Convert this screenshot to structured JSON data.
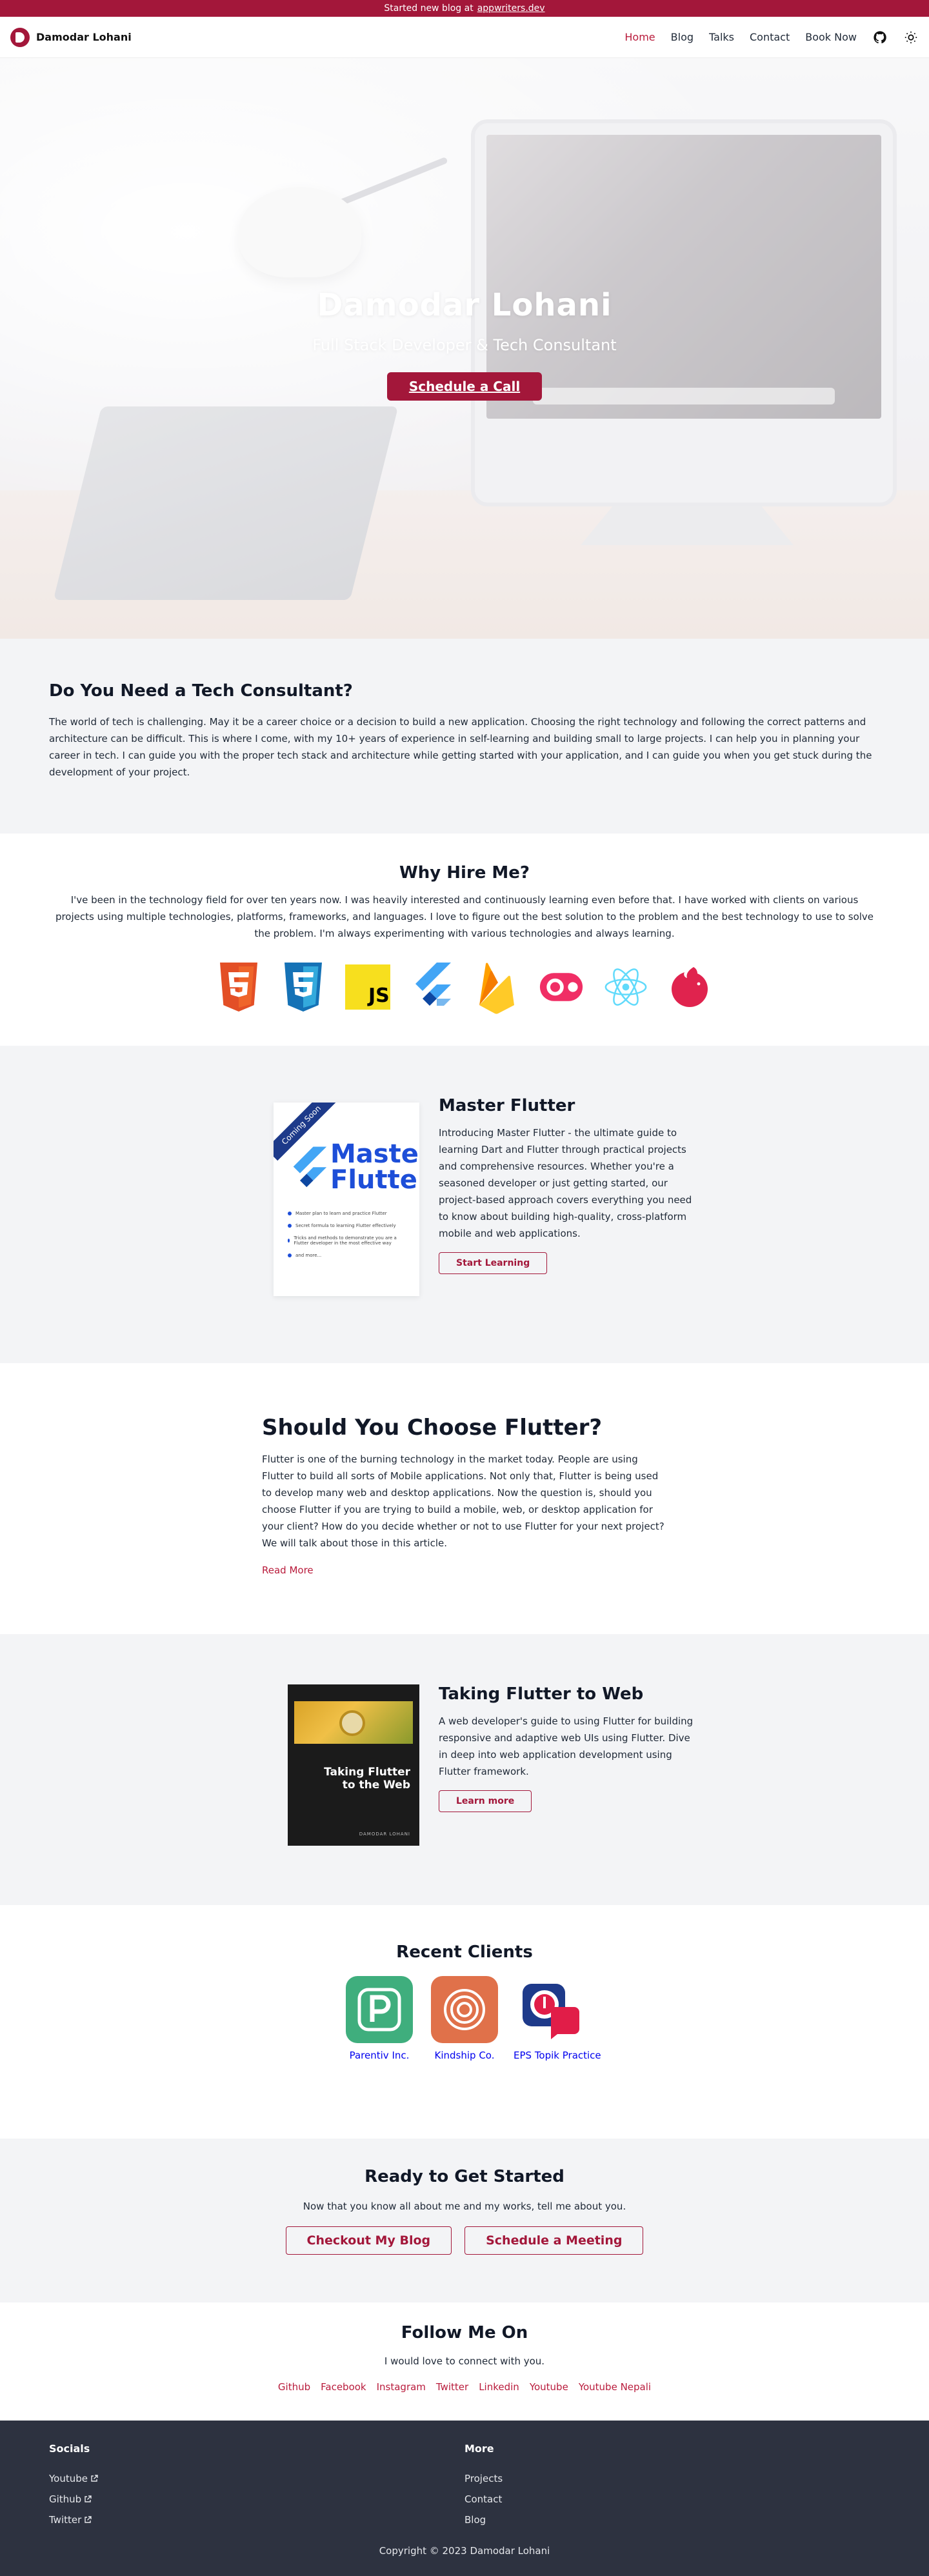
{
  "announcement": {
    "text": "Started new blog at",
    "link": "appwriters.dev"
  },
  "nav": {
    "brand": "Damodar Lohani",
    "links": [
      "Home",
      "Blog",
      "Talks",
      "Contact",
      "Book Now"
    ],
    "active_index": 0,
    "icons": [
      "github-icon",
      "sun-icon"
    ]
  },
  "hero": {
    "title": "Damodar Lohani",
    "subtitle": "Full Stack Developer & Tech Consultant",
    "cta": "Schedule a Call"
  },
  "consultant": {
    "title": "Do You Need a Tech Consultant?",
    "body": "The world of tech is challenging. May it be a career choice or a decision to build a new application. Choosing the right technology and following the correct patterns and architecture can be difficult. This is where I come, with my 10+ years of experience in self-learning and building small to large projects. I can help you in planning your career in tech. I can guide you with the proper tech stack and architecture while getting started with your application, and I can guide you when you get stuck during the development of your project."
  },
  "why_hire": {
    "title": "Why Hire Me?",
    "body": "I've been in the technology field for over ten years now. I was heavily interested and continuously learning even before that. I have worked with clients on various projects using multiple technologies, platforms, frameworks, and languages. I love to figure out the best solution to the problem and the best technology to use to solve the problem. I'm always experimenting with various technologies and always learning.",
    "tech_icons": [
      "html5-icon",
      "css3-icon",
      "javascript-icon",
      "flutter-icon",
      "firebase-icon",
      "appwrite-icon",
      "react-icon",
      "nestjs-icon"
    ]
  },
  "master_flutter": {
    "title": "Master Flutter",
    "body": "Introducing Master Flutter - the ultimate guide to learning Dart and Flutter through practical projects and comprehensive resources. Whether you're a seasoned developer or just getting started, our project-based approach covers everything you need to know about building high-quality, cross-platform mobile and web applications.",
    "button": "Start Learning",
    "cover": {
      "ribbon": "Coming Soon",
      "title_line1": "Master",
      "title_line2": "Flutter",
      "bullets": [
        "Master plan to learn and practice Flutter",
        "Secret formula to learning Flutter effectively",
        "Tricks and methods to demonstrate you are a Flutter developer in the most effective way",
        "and more..."
      ]
    }
  },
  "choose_flutter": {
    "title": "Should You Choose Flutter?",
    "body": "Flutter is one of the burning technology in the market today. People are using Flutter to build all sorts of Mobile applications. Not only that, Flutter is being used to develop many web and desktop applications. Now the question is, should you choose Flutter if you are trying to build a mobile, web, or desktop application for your client? How do you decide whether or not to use Flutter for your next project? We will talk about those in this article.",
    "link": "Read More"
  },
  "flutter_web": {
    "title": "Taking Flutter to Web",
    "body": "A web developer's guide to using Flutter for building responsive and adaptive web UIs using Flutter. Dive in deep into web application development using Flutter framework.",
    "button": "Learn more",
    "cover": {
      "title_line1": "Taking Flutter",
      "title_line2": "to the Web",
      "author": "DAMODAR LOHANI"
    }
  },
  "clients": {
    "title": "Recent Clients",
    "items": [
      {
        "name": "Parentiv Inc.",
        "color": "#3fae7d"
      },
      {
        "name": "Kindship Co.",
        "color": "#e0714a"
      },
      {
        "name": "EPS Topik Practice",
        "color": "#1e3a8a"
      }
    ]
  },
  "ready": {
    "title": "Ready to Get Started",
    "body": "Now that you know all about me and my works, tell me about you.",
    "buttons": [
      "Checkout My Blog",
      "Schedule a Meeting"
    ]
  },
  "follow": {
    "title": "Follow Me On",
    "body": "I would love to connect with you.",
    "links": [
      "Github",
      "Facebook",
      "Instagram",
      "Twitter",
      "Linkedin",
      "Youtube",
      "Youtube Nepali"
    ]
  },
  "footer": {
    "socials_title": "Socials",
    "socials": [
      "Youtube",
      "Github",
      "Twitter"
    ],
    "more_title": "More",
    "more": [
      "Projects",
      "Contact",
      "Blog"
    ],
    "copyright": "Copyright © 2023 Damodar Lohani"
  },
  "colors": {
    "brand": "#a3173a",
    "footer_bg": "#2d3240",
    "section_bg": "#f3f4f6"
  }
}
